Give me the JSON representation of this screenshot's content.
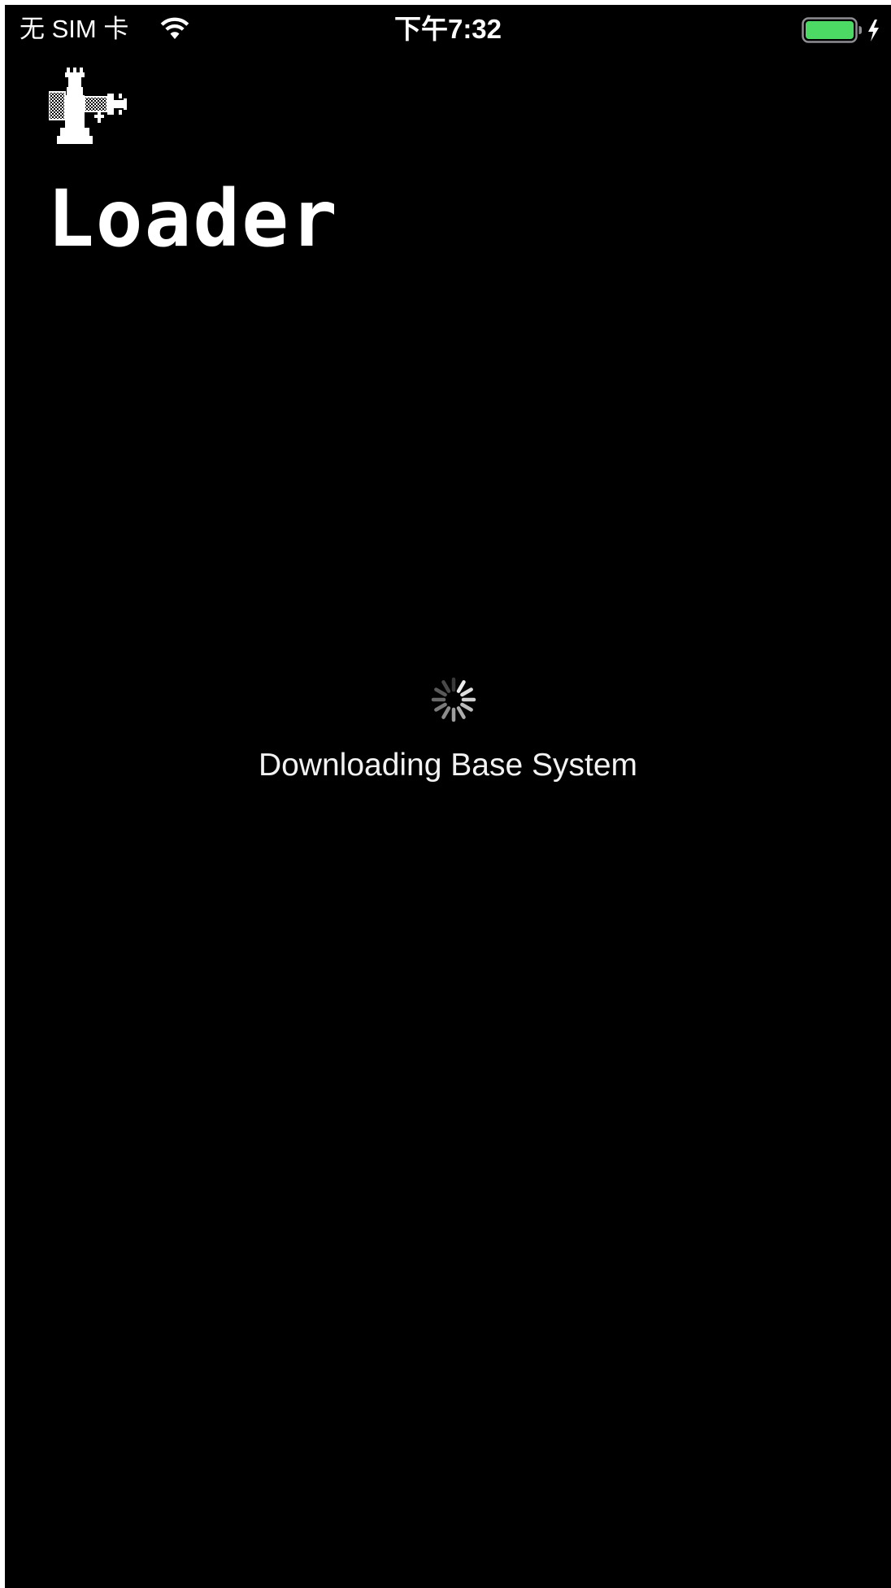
{
  "status_bar": {
    "carrier": "无 SIM 卡",
    "time": "下午7:32",
    "wifi_icon": "wifi-icon",
    "battery_icon": "battery-charging-icon",
    "battery_level": 1.0,
    "battery_color": "#4cd964"
  },
  "app": {
    "logo_icon": "chess-rook-cannon-logo",
    "title": "Loader"
  },
  "loading": {
    "spinner_icon": "activity-spinner-icon",
    "message": "Downloading Base System"
  },
  "colors": {
    "background": "#000000",
    "text": "#ffffff"
  }
}
